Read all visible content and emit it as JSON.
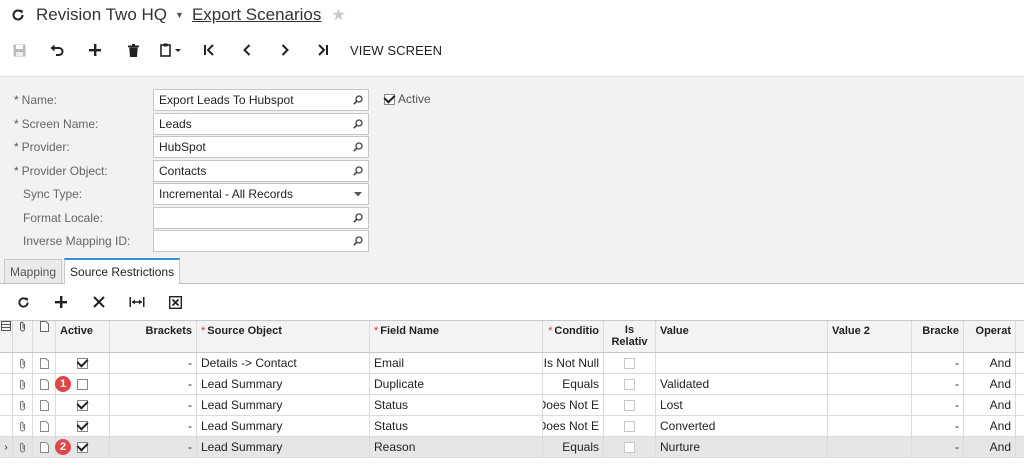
{
  "header": {
    "company": "Revision Two HQ",
    "screen_title": "Export Scenarios"
  },
  "toolbar": {
    "view_screen_label": "VIEW SCREEN"
  },
  "form": {
    "name": {
      "label": "Name:",
      "value": "Export Leads To Hubspot"
    },
    "screen_name": {
      "label": "Screen Name:",
      "value": "Leads"
    },
    "provider": {
      "label": "Provider:",
      "value": "HubSpot"
    },
    "provider_object": {
      "label": "Provider Object:",
      "value": "Contacts"
    },
    "sync_type": {
      "label": "Sync Type:",
      "value": "Incremental - All Records"
    },
    "format_locale": {
      "label": "Format Locale:",
      "value": ""
    },
    "inverse_mapping": {
      "label": "Inverse Mapping ID:",
      "value": ""
    },
    "active_label": "Active",
    "active_checked": true
  },
  "tabs": [
    {
      "label": "Mapping",
      "active": false
    },
    {
      "label": "Source Restrictions",
      "active": true
    }
  ],
  "grid": {
    "columns": {
      "active": "Active",
      "brackets": "Brackets",
      "source_object": "Source Object",
      "field_name": "Field Name",
      "condition": "Conditio",
      "is_relative_1": "Is",
      "is_relative_2": "Relativ",
      "value": "Value",
      "value2": "Value 2",
      "brackets2": "Bracke",
      "operator": "Operat"
    },
    "rows": [
      {
        "active": true,
        "brackets": "-",
        "source_object": "Details -> Contact",
        "field_name": "Email",
        "condition": "Is Not Null",
        "value": "",
        "value2": "",
        "brackets2": "-",
        "operator": "And",
        "badge": "",
        "selected": false
      },
      {
        "active": false,
        "brackets": "-",
        "source_object": "Lead Summary",
        "field_name": "Duplicate",
        "condition": "Equals",
        "value": "Validated",
        "value2": "",
        "brackets2": "-",
        "operator": "And",
        "badge": "1",
        "selected": false
      },
      {
        "active": true,
        "brackets": "-",
        "source_object": "Lead Summary",
        "field_name": "Status",
        "condition": "Does Not E",
        "value": "Lost",
        "value2": "",
        "brackets2": "-",
        "operator": "And",
        "badge": "",
        "selected": false
      },
      {
        "active": true,
        "brackets": "-",
        "source_object": "Lead Summary",
        "field_name": "Status",
        "condition": "Does Not E",
        "value": "Converted",
        "value2": "",
        "brackets2": "-",
        "operator": "And",
        "badge": "",
        "selected": false
      },
      {
        "active": true,
        "brackets": "-",
        "source_object": "Lead Summary",
        "field_name": "Reason",
        "condition": "Equals",
        "value": "Nurture",
        "value2": "",
        "brackets2": "-",
        "operator": "And",
        "badge": "2",
        "selected": true
      }
    ]
  }
}
